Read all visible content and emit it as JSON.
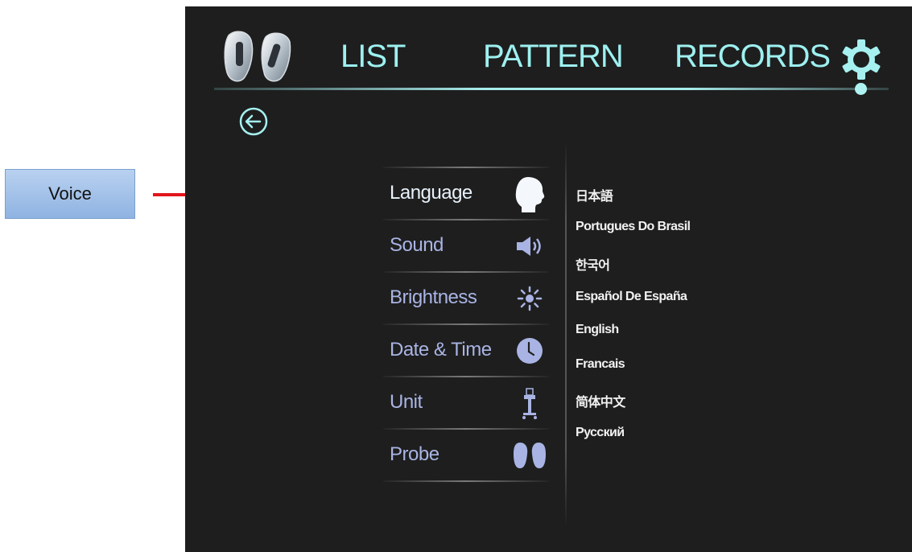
{
  "annotation": {
    "label": "Voice",
    "line_color": "#e3151b"
  },
  "nav": {
    "tabs": [
      "LIST",
      "PATTERN",
      "RECORDS"
    ],
    "accent_color": "#9ef0f0",
    "logo_icon": "probe-pair-icon",
    "settings_icon": "gear-icon"
  },
  "back": {
    "icon": "back-arrow-icon"
  },
  "menu": {
    "items": [
      {
        "label": "Language",
        "icon": "head-profile-icon",
        "active": true
      },
      {
        "label": "Sound",
        "icon": "speaker-icon",
        "active": false
      },
      {
        "label": "Brightness",
        "icon": "sun-icon",
        "active": false
      },
      {
        "label": "Date & Time",
        "icon": "clock-icon",
        "active": false
      },
      {
        "label": "Unit",
        "icon": "cart-icon",
        "active": false
      },
      {
        "label": "Probe",
        "icon": "probes-icon",
        "active": false
      }
    ]
  },
  "languages": [
    "日本語",
    "Portugues Do Brasil",
    "한국어",
    "Español De España",
    "English",
    "Francais",
    "简体中文",
    "Русский"
  ]
}
